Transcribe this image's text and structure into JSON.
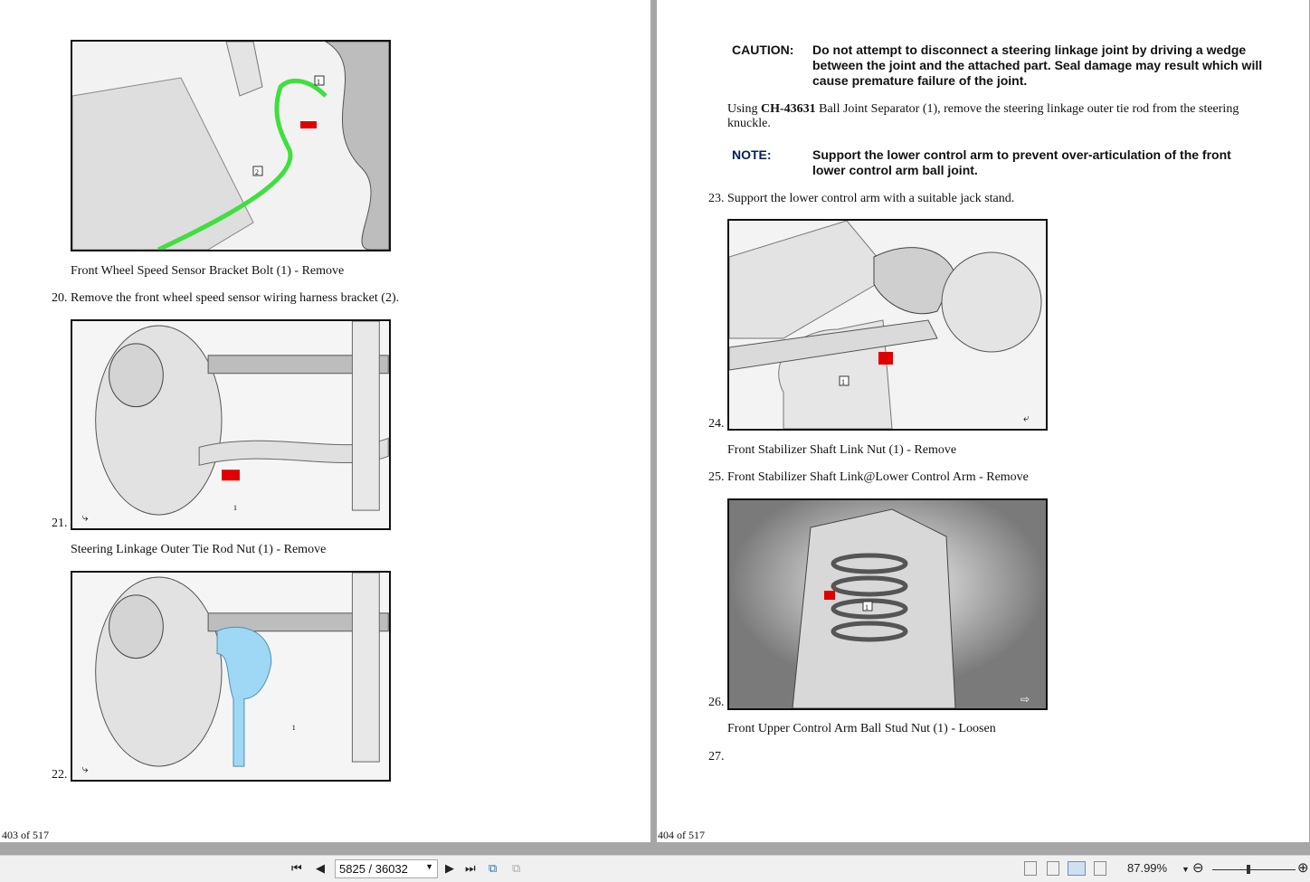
{
  "left_page": {
    "captions": [
      {
        "text": "Front Wheel Speed Sensor Bracket Bolt (1) - Remove"
      },
      {
        "text": "20. Remove the front wheel speed sensor wiring harness bracket (2)."
      },
      {
        "text": "Steering Linkage Outer Tie Rod Nut (1) - Remove"
      }
    ],
    "steps": [
      "21.",
      "22."
    ],
    "figure_callouts": [
      "1",
      "2",
      "1",
      "1"
    ],
    "footer": "403 of 517"
  },
  "right_page": {
    "caution_label": "CAUTION:",
    "caution_lines": [
      "Do not attempt to disconnect a steering linkage joint by driving a wedge",
      "between the joint and the attached part. Seal damage may result which will",
      "cause premature failure of the joint."
    ],
    "using_prefix": "Using ",
    "tool": "CH-43631",
    "using_line1": " Ball Joint Separator (1), remove the steering linkage outer tie rod from the steering",
    "using_line2": "knuckle.",
    "note_label": "NOTE:",
    "note_lines": [
      "Support the lower control arm to prevent over-articulation of the front",
      "lower control arm ball joint."
    ],
    "step23": "23. Support the lower control arm with a suitable jack stand.",
    "steps": [
      "24.",
      "26.",
      "27."
    ],
    "captions": [
      {
        "text": "Front Stabilizer Shaft Link Nut (1) - Remove"
      },
      {
        "text": "25. Front Stabilizer Shaft Link@Lower Control Arm - Remove"
      },
      {
        "text": "Front Upper Control Arm Ball Stud Nut (1) - Loosen"
      }
    ],
    "figure_callouts": [
      "1",
      "1"
    ],
    "footer": "404 of 517"
  },
  "toolbar": {
    "page_value": "5825 / 36032",
    "zoom": "87.99%",
    "zoom_slider_fraction": 0.45
  },
  "colors": {
    "highlight": "#e00000",
    "wire": "#3ee03e",
    "tool": "#9fd8f5",
    "label": "#00205a"
  }
}
